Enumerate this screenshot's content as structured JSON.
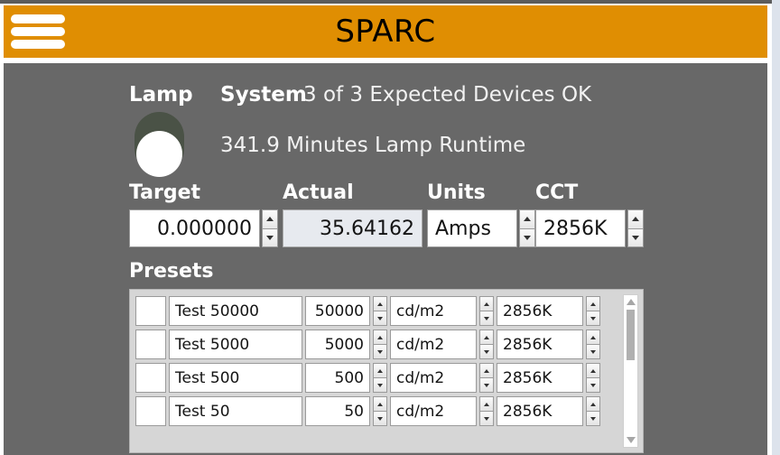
{
  "header": {
    "title": "SPARC",
    "menu_icon": "hamburger-menu-icon",
    "accent_color": "#E08E02"
  },
  "status": {
    "lamp_label": "Lamp",
    "lamp_state": "off",
    "system_label": "System",
    "system_status": "3 of 3 Expected Devices OK",
    "runtime": "341.9 Minutes Lamp Runtime"
  },
  "controls": {
    "target": {
      "label": "Target",
      "value": "0.000000",
      "has_spinner": true
    },
    "actual": {
      "label": "Actual",
      "value": "35.64162",
      "has_spinner": false,
      "readonly": true
    },
    "units": {
      "label": "Units",
      "value": "Amps",
      "has_spinner": true
    },
    "cct": {
      "label": "CCT",
      "value": "2856K",
      "has_spinner": true
    }
  },
  "presets": {
    "label": "Presets",
    "rows": [
      {
        "selected": false,
        "name": "Test 50000",
        "value": "50000",
        "units": "cd/m2",
        "cct": "2856K"
      },
      {
        "selected": false,
        "name": "Test 5000",
        "value": "5000",
        "units": "cd/m2",
        "cct": "2856K"
      },
      {
        "selected": false,
        "name": "Test 500",
        "value": "500",
        "units": "cd/m2",
        "cct": "2856K"
      },
      {
        "selected": false,
        "name": "Test 50",
        "value": "50",
        "units": "cd/m2",
        "cct": "2856K"
      }
    ],
    "scroll_position": "top"
  },
  "theme": {
    "background": "#686868",
    "header": "#E08E02",
    "lamp_track": "#4A5246",
    "lamp_knob": "#FFFFFF"
  }
}
